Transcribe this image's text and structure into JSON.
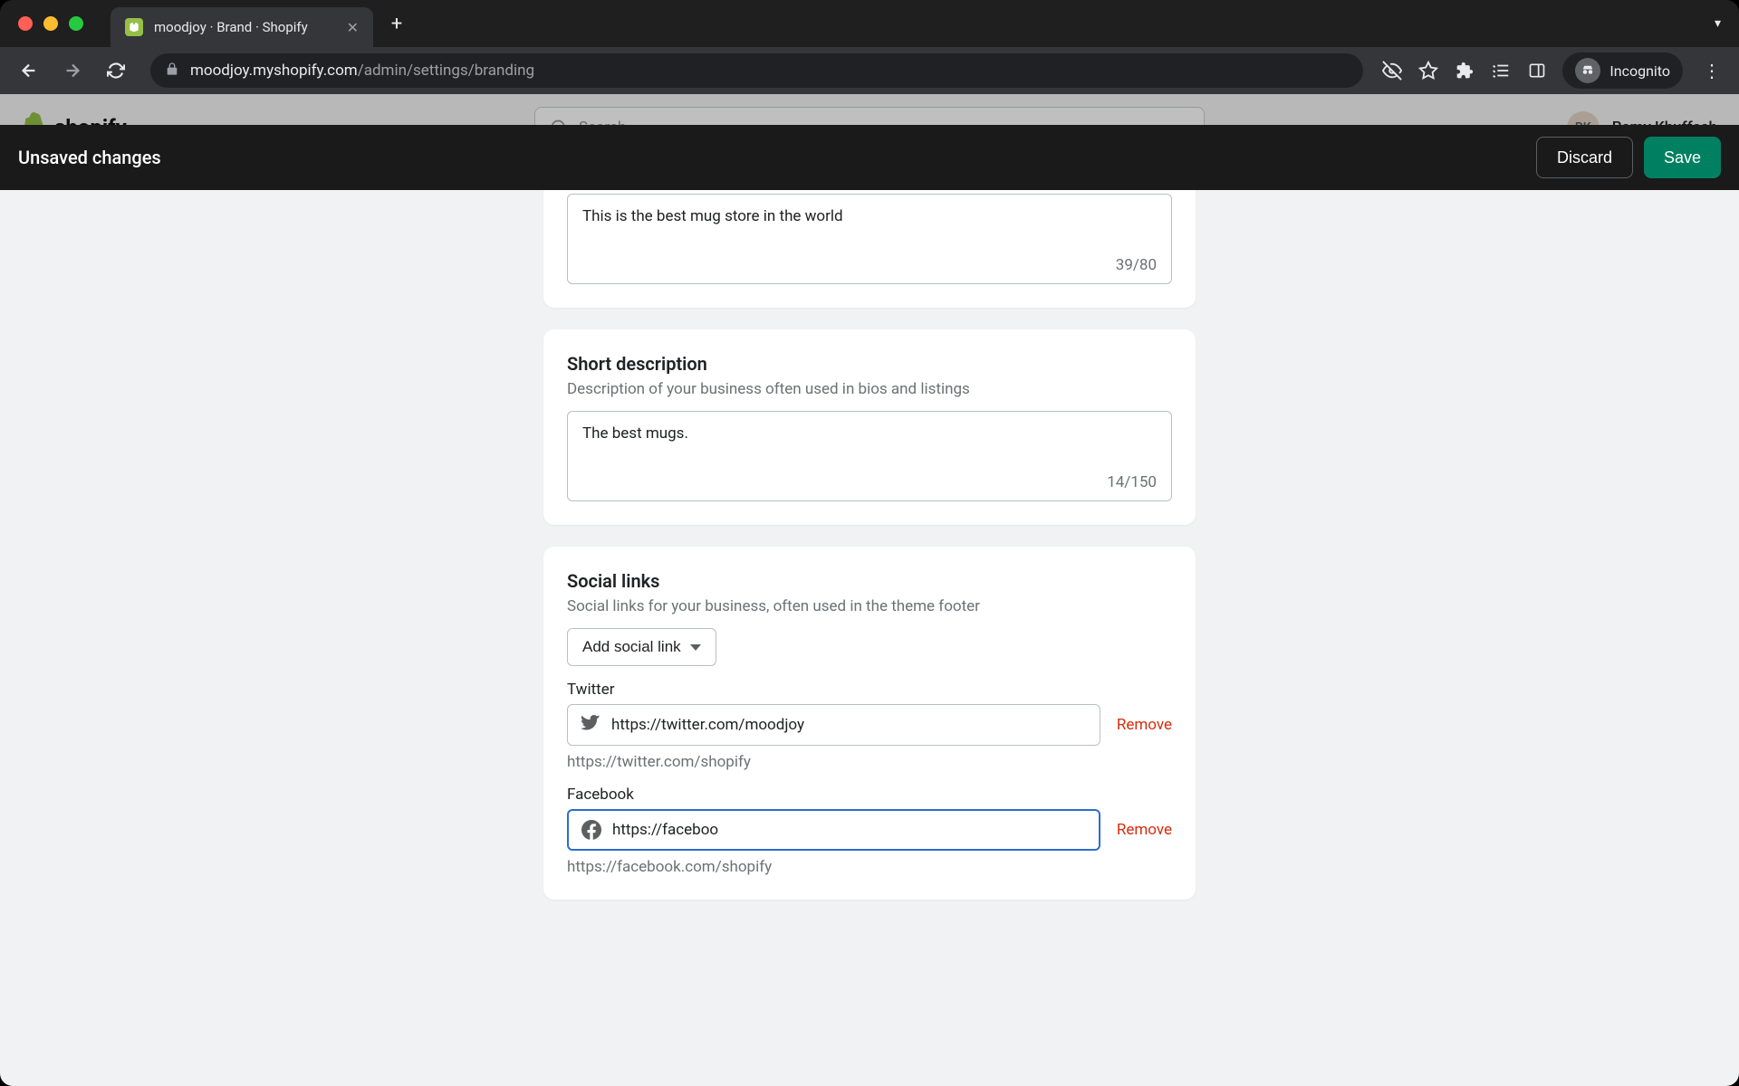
{
  "browser": {
    "tab_title": "moodjoy · Brand · Shopify",
    "url_host": "moodjoy.myshopify.com",
    "url_path": "/admin/settings/branding",
    "incognito_label": "Incognito"
  },
  "shopify_header": {
    "logo_text": "shopify",
    "search_placeholder": "Search",
    "user_initials": "RK",
    "user_name": "Ramy Khuffash"
  },
  "unsaved_bar": {
    "message": "Unsaved changes",
    "discard": "Discard",
    "save": "Save"
  },
  "slogan_card": {
    "value": "This is the best mug store in the world",
    "count": "39/80"
  },
  "short_desc_card": {
    "title": "Short description",
    "subtitle": "Description of your business often used in bios and listings",
    "value": "The best mugs.",
    "count": "14/150"
  },
  "social_card": {
    "title": "Social links",
    "subtitle": "Social links for your business, often used in the theme footer",
    "add_button": "Add social link",
    "twitter": {
      "label": "Twitter",
      "value": "https://twitter.com/moodjoy",
      "hint": "https://twitter.com/shopify",
      "remove": "Remove"
    },
    "facebook": {
      "label": "Facebook",
      "value": "https://faceboo",
      "hint": "https://facebook.com/shopify",
      "remove": "Remove"
    }
  }
}
